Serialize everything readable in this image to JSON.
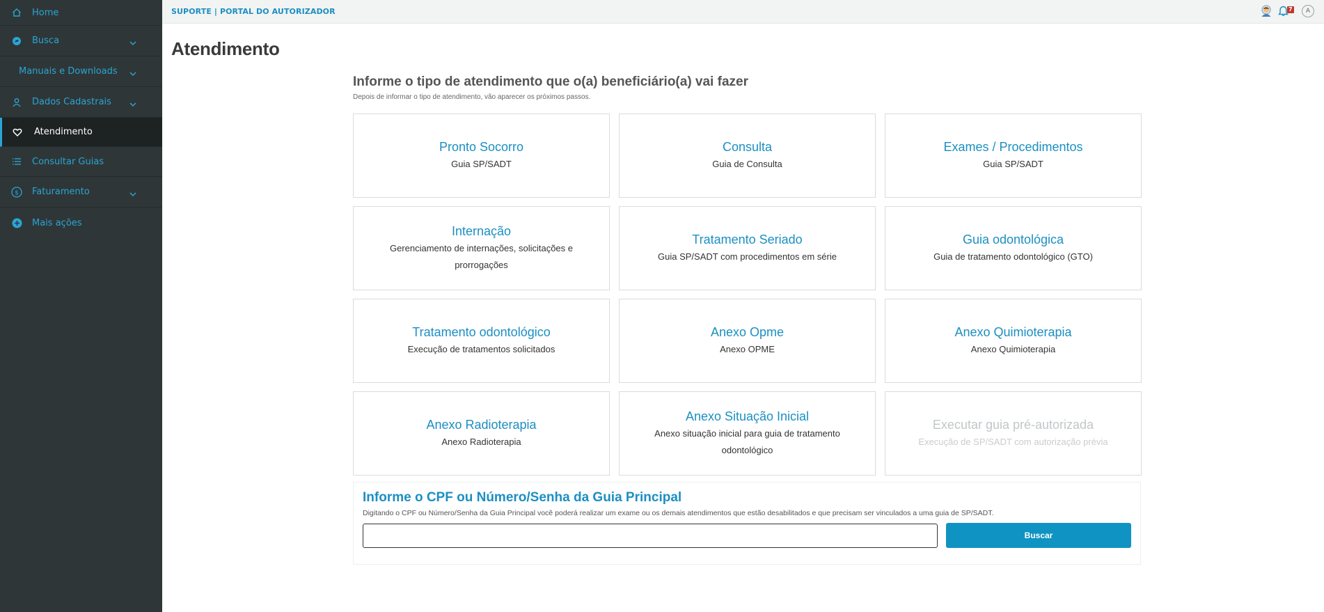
{
  "sidebar": {
    "items": [
      {
        "label": "Home",
        "icon": "home-icon"
      },
      {
        "label": "Busca",
        "icon": "bird-icon"
      },
      {
        "label": "Manuais e Downloads"
      },
      {
        "label": "Dados Cadastrais",
        "icon": "user-icon"
      },
      {
        "label": "Atendimento",
        "icon": "heart-icon"
      },
      {
        "label": "Consultar Guias",
        "icon": "list-icon"
      },
      {
        "label": "Faturamento",
        "icon": "dollar-icon"
      },
      {
        "label": "Mais ações",
        "icon": "plus-circle-icon"
      }
    ]
  },
  "header": {
    "brand": "SUPORTE | PORTAL DO AUTORIZADOR",
    "notifications_count": "7",
    "user_initial": "A"
  },
  "main": {
    "title": "Atendimento",
    "intro_title": "Informe o tipo de atendimento que o(a) beneficiário(a) vai fazer",
    "intro_subtitle": "Depois de informar o tipo de atendimento, vão aparecer os próximos passos.",
    "cards": [
      {
        "title": "Pronto Socorro",
        "subtitle": "Guia SP/SADT"
      },
      {
        "title": "Consulta",
        "subtitle": "Guia de Consulta"
      },
      {
        "title": "Exames / Procedimentos",
        "subtitle": "Guia SP/SADT"
      },
      {
        "title": "Internação",
        "subtitle": "Gerenciamento de internações, solicitações e prorrogações"
      },
      {
        "title": "Tratamento Seriado",
        "subtitle": "Guia SP/SADT com procedimentos em série"
      },
      {
        "title": "Guia odontológica",
        "subtitle": "Guia de tratamento odontológico (GTO)"
      },
      {
        "title": "Tratamento odontológico",
        "subtitle": "Execução de tratamentos solicitados"
      },
      {
        "title": "Anexo Opme",
        "subtitle": "Anexo OPME"
      },
      {
        "title": "Anexo Quimioterapia",
        "subtitle": "Anexo Quimioterapia"
      },
      {
        "title": "Anexo Radioterapia",
        "subtitle": "Anexo Radioterapia"
      },
      {
        "title": "Anexo Situação Inicial",
        "subtitle": "Anexo situação inicial para guia de tratamento odontológico"
      },
      {
        "title": "Executar guia pré-autorizada",
        "subtitle": "Execução de SP/SADT com autorização prévia"
      }
    ],
    "cpf": {
      "title": "Informe o CPF ou Número/Senha da Guia Principal",
      "description": "Digitando o CPF ou Número/Senha da Guia Principal você poderá realizar um exame ou os demais atendimentos que estão desabilitados e que precisam ser vinculados a uma guia de SP/SADT.",
      "input_value": "",
      "button_label": "Buscar"
    }
  },
  "colors": {
    "accent": "#1b8fc2",
    "sidebar_bg": "#2f3637",
    "button_bg": "#0f93c2",
    "disabled_text": "#c2c6c8"
  }
}
